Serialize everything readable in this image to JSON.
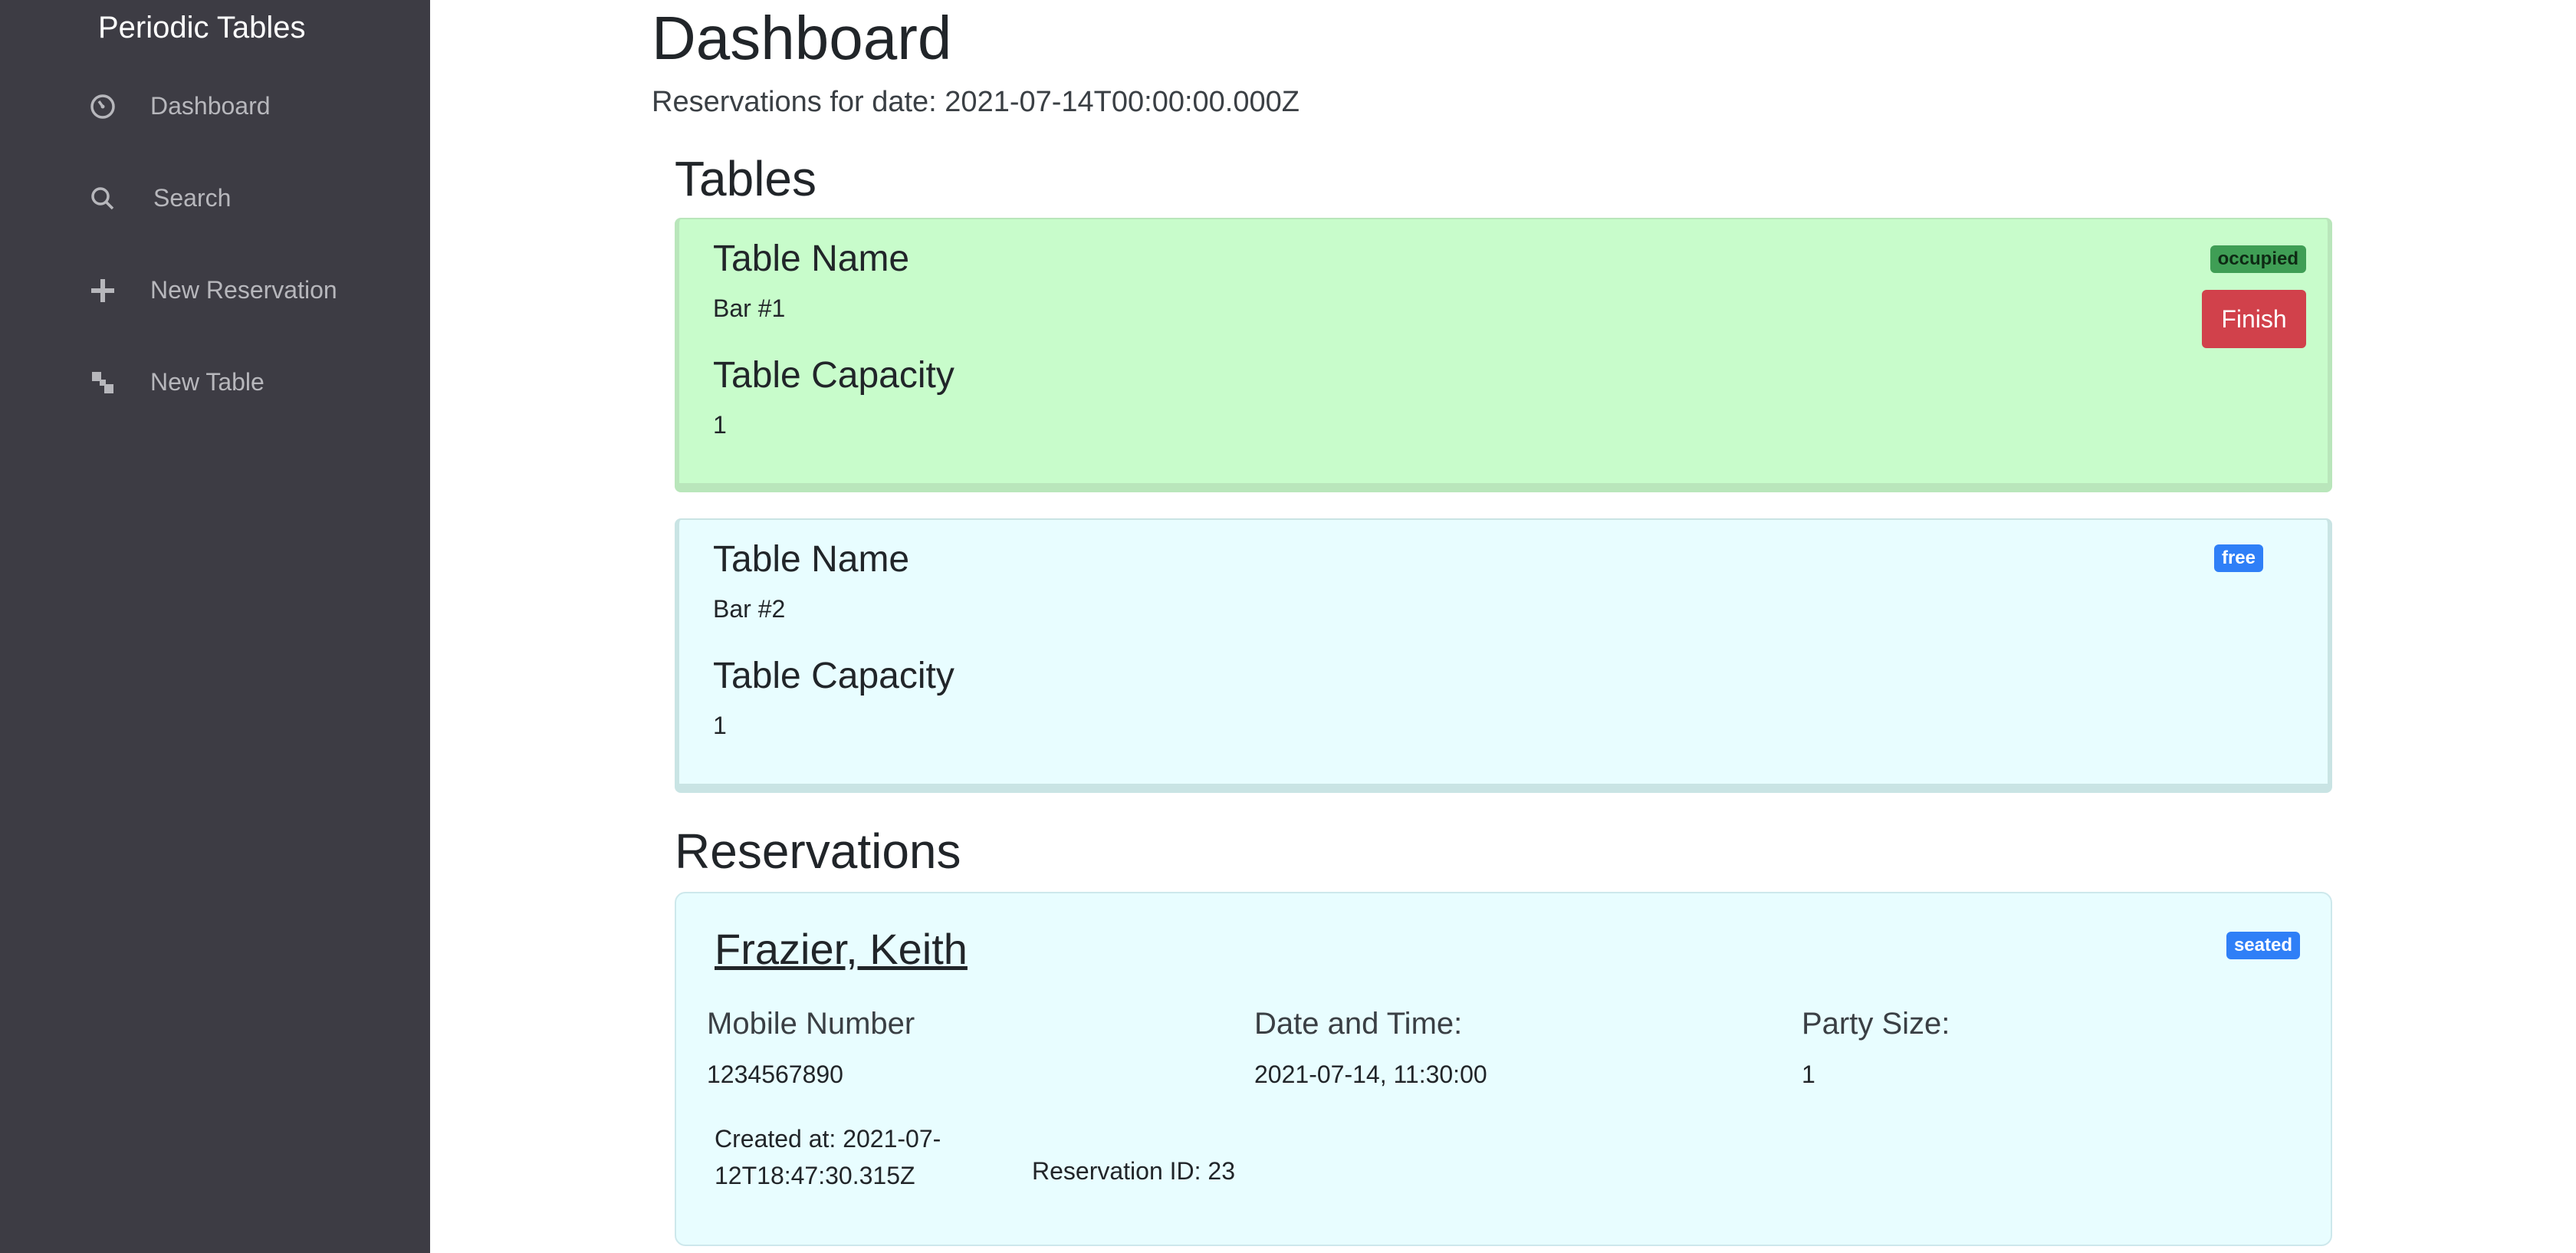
{
  "sidebar": {
    "brand": "Periodic Tables",
    "items": [
      {
        "label": "Dashboard",
        "icon": "dashboard-icon"
      },
      {
        "label": "Search",
        "icon": "search-icon"
      },
      {
        "label": "New Reservation",
        "icon": "plus-icon"
      },
      {
        "label": "New Table",
        "icon": "new-table-icon"
      }
    ]
  },
  "main": {
    "title": "Dashboard",
    "date_line": "Reservations for date: 2021-07-14T00:00:00.000Z",
    "tables_heading": "Tables",
    "reservations_heading": "Reservations"
  },
  "tables": [
    {
      "name_label": "Table Name",
      "name": "Bar #1",
      "capacity_label": "Table Capacity",
      "capacity": "1",
      "status": "occupied",
      "finish_label": "Finish"
    },
    {
      "name_label": "Table Name",
      "name": "Bar #2",
      "capacity_label": "Table Capacity",
      "capacity": "1",
      "status": "free"
    }
  ],
  "reservations": [
    {
      "name": "Frazier, Keith",
      "status": "seated",
      "mobile_label": "Mobile Number",
      "mobile": "1234567890",
      "datetime_label": "Date and Time:",
      "datetime": "2021-07-14, 11:30:00",
      "party_label": "Party Size:",
      "party": "1",
      "created": "Created at: 2021-07-12T18:47:30.315Z",
      "reservation_id": "Reservation ID: 23"
    }
  ],
  "colors": {
    "sidebar_bg": "#3d3c44",
    "occupied_card": "#c8fccb",
    "free_card": "#e8fdff",
    "finish_button": "#d1414b",
    "badge_blue": "#2f7ff7",
    "badge_green": "#3f9e55"
  }
}
